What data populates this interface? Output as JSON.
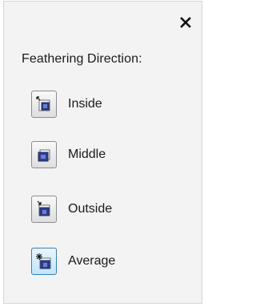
{
  "panel": {
    "close_glyph": "✕",
    "heading": "Feathering Direction:",
    "options": [
      {
        "label": "Inside",
        "icon": "feather-inside-icon",
        "selected": false
      },
      {
        "label": "Middle",
        "icon": "feather-middle-icon",
        "selected": false
      },
      {
        "label": "Outside",
        "icon": "feather-outside-icon",
        "selected": false
      },
      {
        "label": "Average",
        "icon": "feather-average-icon",
        "selected": true
      }
    ]
  },
  "colors": {
    "panel_bg": "#f3f3f3",
    "selected_border": "#3c7fb1",
    "icon_square": "#2f3d8c"
  }
}
